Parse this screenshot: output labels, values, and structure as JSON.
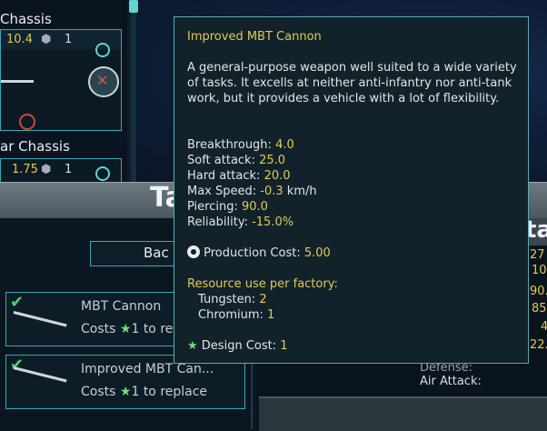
{
  "background": {
    "chassis": [
      {
        "title": "Chassis",
        "stat": "10.4",
        "count": "1"
      },
      {
        "title": "ar Chassis",
        "stat": "1.75",
        "count": "1"
      }
    ],
    "panel_title": "Ta",
    "back_label": "Bac",
    "weapons": [
      {
        "name": "MBT Cannon",
        "cost_prefix": "Costs",
        "cost_star": "★",
        "cost_value": "1",
        "cost_suffix": "to re"
      },
      {
        "name": "Improved MBT Can...",
        "cost_prefix": "Costs",
        "cost_star": "★",
        "cost_value": "1",
        "cost_suffix": "to replace"
      }
    ],
    "right_header": "ta",
    "right_numbers": [
      "27",
      "10",
      "90.",
      "85",
      "4",
      "22."
    ],
    "right_labels": [
      "Defense:",
      "Air Attack:"
    ]
  },
  "tooltip": {
    "title": "Improved MBT Cannon",
    "description": "A general-purpose weapon well suited to a wide variety of tasks. It excells at neither anti-infantry nor anti-tank work, but it provides a vehicle with a lot of flexibility.",
    "stats": [
      {
        "label": "Breakthrough:",
        "value": "4.0",
        "unit": ""
      },
      {
        "label": "Soft attack:",
        "value": "25.0",
        "unit": ""
      },
      {
        "label": "Hard attack:",
        "value": "20.0",
        "unit": ""
      },
      {
        "label": "Max Speed:",
        "value": "-0.3",
        "unit": "km/h"
      },
      {
        "label": "Piercing:",
        "value": "90.0",
        "unit": ""
      },
      {
        "label": "Reliability:",
        "value": "-15.0%",
        "unit": ""
      }
    ],
    "production_cost_label": "Production Cost:",
    "production_cost_value": "5.00",
    "resource_header": "Resource use per factory:",
    "resources": [
      {
        "label": "Tungsten:",
        "value": "2"
      },
      {
        "label": "Chromium:",
        "value": "1"
      }
    ],
    "design_cost_label": "Design Cost:",
    "design_cost_value": "1"
  },
  "colors": {
    "accent": "#3aa6b3",
    "highlight": "#e0cb52",
    "star": "#6fdc7a"
  }
}
